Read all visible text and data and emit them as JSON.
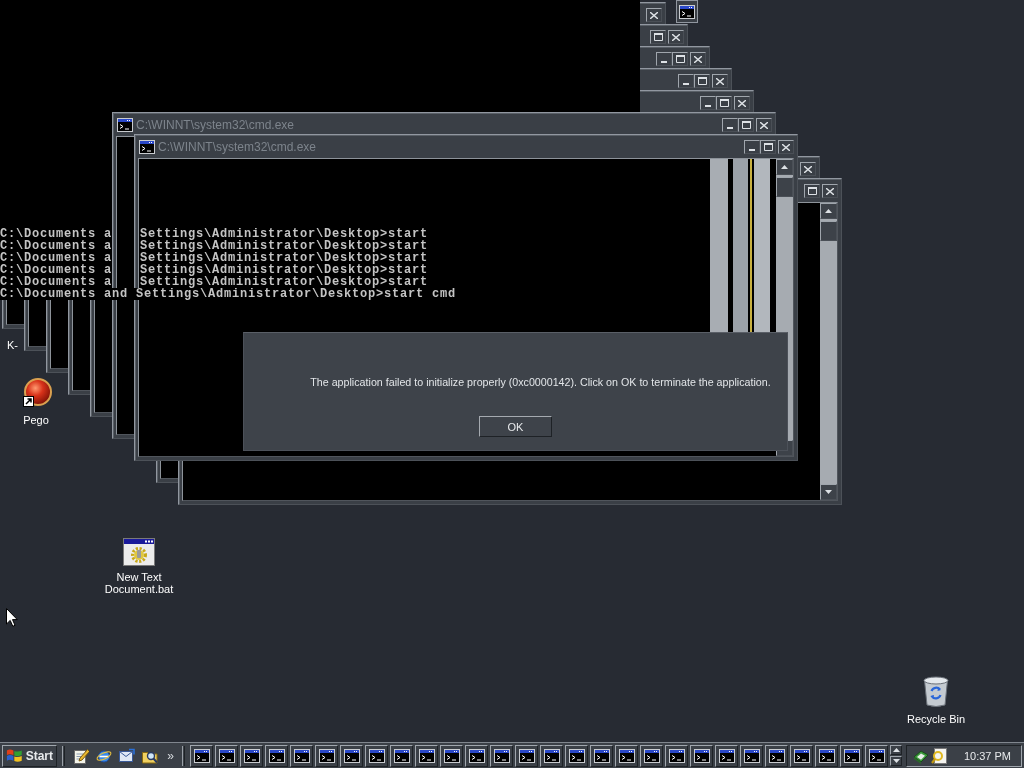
{
  "windows": [
    {
      "kind": "fragment"
    },
    {
      "kind": "console"
    },
    {
      "kind": "console"
    },
    {
      "kind": "console"
    },
    {
      "kind": "console"
    },
    {
      "kind": "console"
    },
    {
      "kind": "console",
      "title": "C:\\WINNT\\system32\\cmd.exe"
    },
    {
      "kind": "console",
      "title": "C:\\WINNT\\system32\\cmd.exe"
    },
    {
      "kind": "console"
    },
    {
      "kind": "console"
    }
  ],
  "console_output": {
    "lines": [
      [
        "C:\\Documents a",
        "Settings\\Administrator\\Desktop>start"
      ],
      [
        "C:\\Documents a",
        "Settings\\Administrator\\Desktop>start"
      ],
      [
        "C:\\Documents a",
        "Settings\\Administrator\\Desktop>start"
      ],
      [
        "C:\\Documents a",
        "Settings\\Administrator\\Desktop>start"
      ],
      [
        "C:\\Documents a",
        "Settings\\Administrator\\Desktop>start"
      ],
      [
        "C:\\Documents and Settings\\Administrator\\Desktop>start cmd"
      ]
    ]
  },
  "dialog": {
    "message": "The application failed to initialize properly (0xc0000142). Click on OK to terminate the application.",
    "buttons": [
      "OK"
    ]
  },
  "desktop_icons": [
    {
      "kind": "covered",
      "label": "K-"
    },
    {
      "kind": "shortcut",
      "label": "Pego"
    },
    {
      "kind": "batch-file",
      "label": "New Text Document.bat"
    },
    {
      "kind": "recycle-bin",
      "label": "Recycle Bin"
    }
  ],
  "taskbar": {
    "start_label": "Start",
    "overflow": "»",
    "window_buttons": [
      {
        "selected": false
      },
      {
        "selected": false
      },
      {
        "selected": false
      },
      {
        "selected": false
      },
      {
        "selected": false
      },
      {
        "selected": false
      },
      {
        "selected": false
      },
      {
        "selected": false
      },
      {
        "selected": false
      },
      {
        "selected": false
      },
      {
        "selected": false
      },
      {
        "selected": false
      },
      {
        "selected": false
      },
      {
        "selected": false
      },
      {
        "selected": false
      },
      {
        "selected": false
      },
      {
        "selected": false
      },
      {
        "selected": false
      },
      {
        "selected": false
      },
      {
        "selected": false
      },
      {
        "selected": false
      },
      {
        "selected": false
      },
      {
        "selected": false
      },
      {
        "selected": false
      },
      {
        "selected": false
      },
      {
        "selected": false
      },
      {
        "selected": false
      },
      {
        "selected": false
      }
    ],
    "clock": "10:37 PM"
  }
}
